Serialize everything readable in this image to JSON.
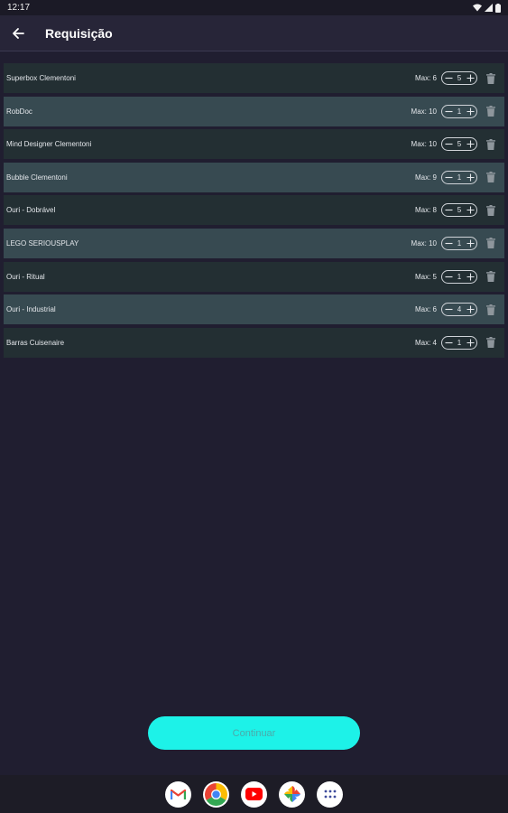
{
  "status_bar": {
    "time": "12:17"
  },
  "app_bar": {
    "title": "Requisição",
    "back_icon": "arrow-back-icon"
  },
  "items": [
    {
      "name": "Superbox Clementoni",
      "max": "Max: 6",
      "qty": "5",
      "shade": "dark"
    },
    {
      "name": "RobDoc",
      "max": "Max: 10",
      "qty": "1",
      "shade": "light"
    },
    {
      "name": "Mind Designer Clementoni",
      "max": "Max: 10",
      "qty": "5",
      "shade": "dark"
    },
    {
      "name": "Bubble Clementoni",
      "max": "Max: 9",
      "qty": "1",
      "shade": "light"
    },
    {
      "name": "Ouri - Dobrável",
      "max": "Max: 8",
      "qty": "5",
      "shade": "dark"
    },
    {
      "name": "LEGO SERIOUSPLAY",
      "max": "Max: 10",
      "qty": "1",
      "shade": "light"
    },
    {
      "name": "Ouri - Ritual",
      "max": "Max: 5",
      "qty": "1",
      "shade": "dark"
    },
    {
      "name": "Ouri - Industrial",
      "max": "Max: 6",
      "qty": "4",
      "shade": "light"
    },
    {
      "name": "Barras Cuisenaire",
      "max": "Max: 4",
      "qty": "1",
      "shade": "dark"
    }
  ],
  "continue_button": {
    "label": "Continuar"
  },
  "dock": {
    "apps": [
      {
        "name": "gmail-icon"
      },
      {
        "name": "chrome-icon"
      },
      {
        "name": "youtube-icon"
      },
      {
        "name": "photos-icon"
      },
      {
        "name": "app-drawer-icon"
      }
    ]
  },
  "colors": {
    "background": "#201e30",
    "row_dark": "#232f33",
    "row_light": "#374a51",
    "accent": "#1df2e8"
  }
}
